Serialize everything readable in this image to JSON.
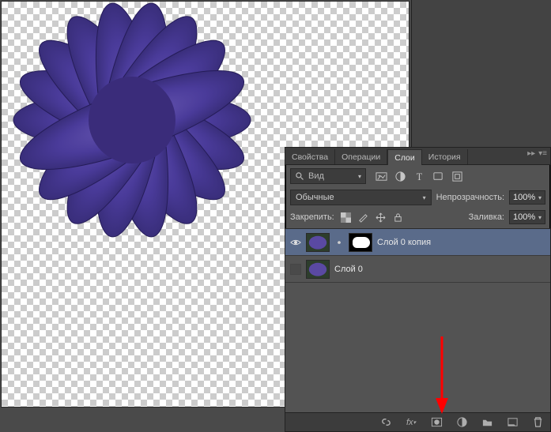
{
  "tabs": [
    {
      "label": "Свойства",
      "active": false
    },
    {
      "label": "Операции",
      "active": false
    },
    {
      "label": "Слои",
      "active": true
    },
    {
      "label": "История",
      "active": false
    }
  ],
  "filter": {
    "search_label": "Вид"
  },
  "blend": {
    "mode": "Обычные",
    "opacity_label": "Непрозрачность:",
    "opacity_value": "100%"
  },
  "lock": {
    "label": "Закрепить:",
    "fill_label": "Заливка:",
    "fill_value": "100%"
  },
  "layers": [
    {
      "name": "Слой 0 копия",
      "visible": true,
      "has_mask": true,
      "selected": true
    },
    {
      "name": "Слой 0",
      "visible": false,
      "has_mask": false,
      "selected": false
    }
  ],
  "footer_icons": [
    "link",
    "fx",
    "mask",
    "adjust",
    "group",
    "new",
    "trash"
  ]
}
